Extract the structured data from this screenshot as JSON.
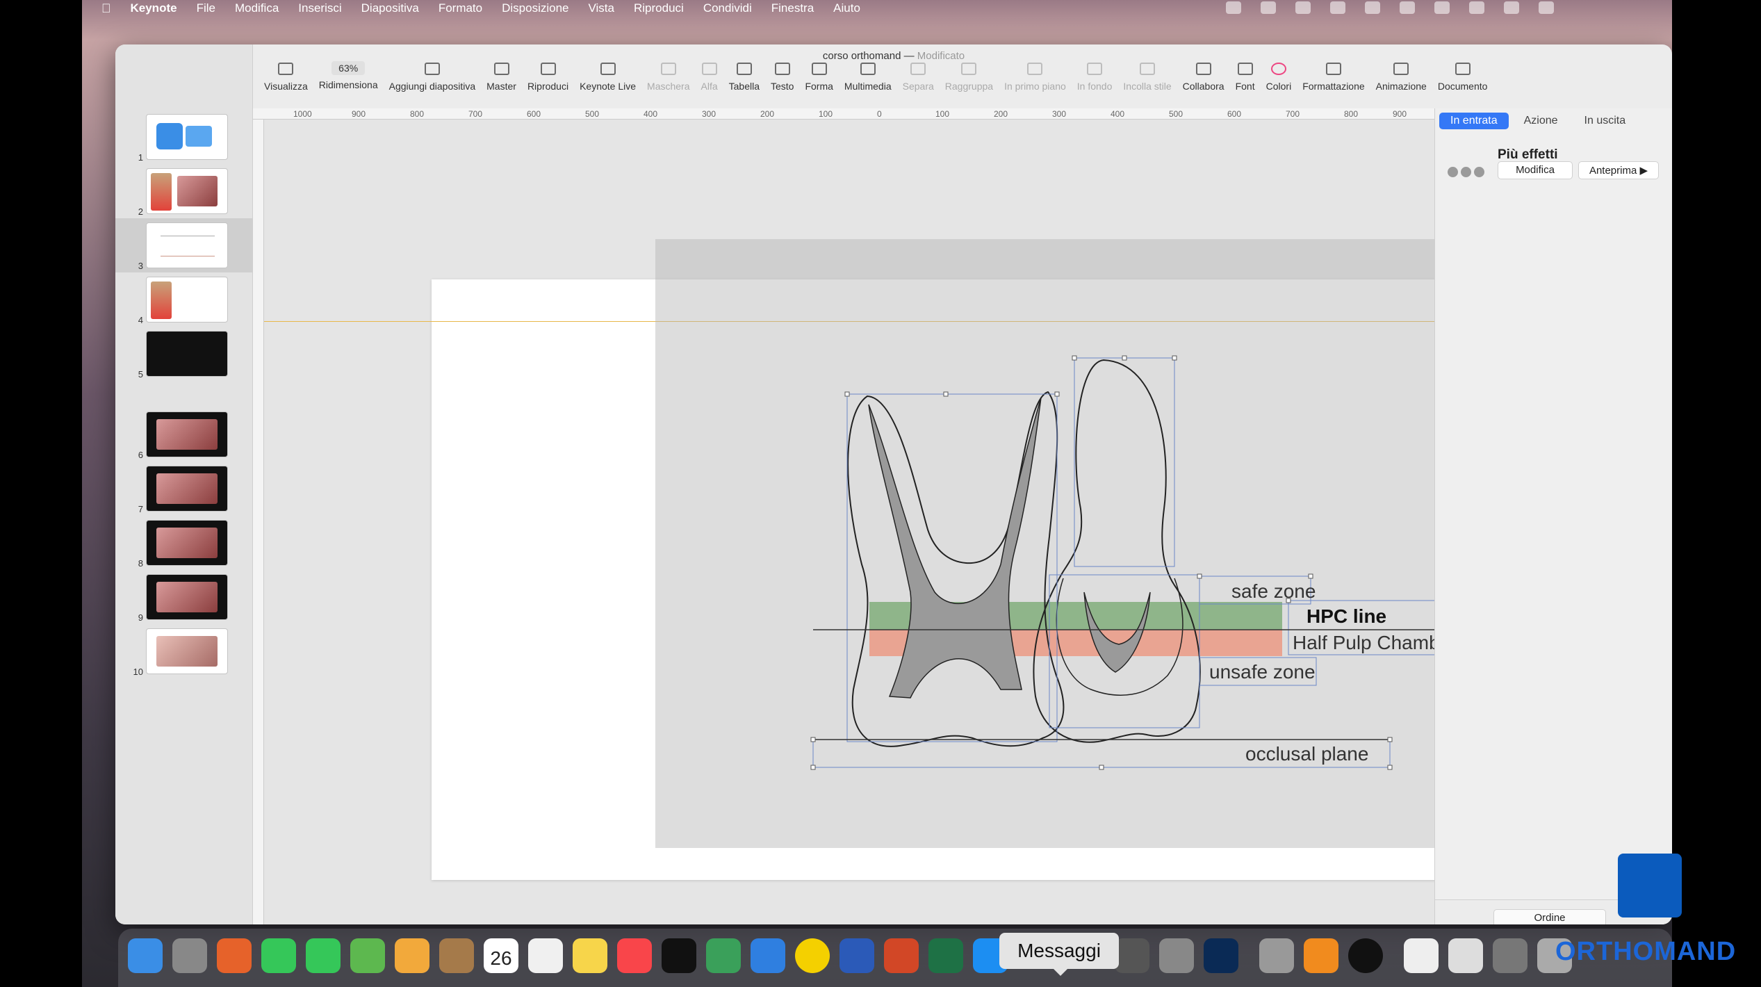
{
  "menubar": {
    "app": "Keynote",
    "items": [
      "File",
      "Modifica",
      "Inserisci",
      "Diapositiva",
      "Formato",
      "Disposizione",
      "Vista",
      "Riproduci",
      "Condividi",
      "Finestra",
      "Aiuto"
    ]
  },
  "window": {
    "title": "corso orthomand",
    "status": "Modificato"
  },
  "toolbar": {
    "zoom": "63%",
    "items": [
      {
        "label": "Visualizza",
        "enabled": true
      },
      {
        "label": "Ridimensiona",
        "enabled": true
      },
      {
        "label": "Aggiungi diapositiva",
        "enabled": true
      },
      {
        "label": "Master",
        "enabled": true
      },
      {
        "label": "Riproduci",
        "enabled": true
      },
      {
        "label": "Keynote Live",
        "enabled": true
      },
      {
        "label": "Maschera",
        "enabled": false
      },
      {
        "label": "Alfa",
        "enabled": false
      },
      {
        "label": "Tabella",
        "enabled": true
      },
      {
        "label": "Testo",
        "enabled": true
      },
      {
        "label": "Forma",
        "enabled": true
      },
      {
        "label": "Multimedia",
        "enabled": true
      },
      {
        "label": "Separa",
        "enabled": false
      },
      {
        "label": "Raggruppa",
        "enabled": false
      },
      {
        "label": "In primo piano",
        "enabled": false
      },
      {
        "label": "In fondo",
        "enabled": false
      },
      {
        "label": "Incolla stile",
        "enabled": false
      },
      {
        "label": "Collabora",
        "enabled": true
      },
      {
        "label": "Font",
        "enabled": true
      },
      {
        "label": "Colori",
        "enabled": true
      },
      {
        "label": "Formattazione",
        "enabled": true
      },
      {
        "label": "Animazione",
        "enabled": true
      },
      {
        "label": "Documento",
        "enabled": true
      }
    ]
  },
  "ruler": {
    "top_labels": [
      "1000",
      "900",
      "800",
      "700",
      "600",
      "500",
      "400",
      "300",
      "200",
      "100",
      "0",
      "100",
      "200",
      "300",
      "400",
      "500",
      "600",
      "700",
      "800",
      "900",
      "1000"
    ]
  },
  "slides": [
    "1",
    "2",
    "3",
    "4",
    "5",
    "6",
    "7",
    "8",
    "9",
    "10"
  ],
  "selected_slide": "3",
  "figure": {
    "safe_zone": "safe zone",
    "hpc_line": "HPC line",
    "half_pulp": "Half Pulp Chamber",
    "unsafe_zone": "unsafe zone",
    "occlusal_plane": "occlusal plane",
    "colors": {
      "safe": "#8fb58a",
      "unsafe": "#e9a492"
    }
  },
  "inspector": {
    "tabs": [
      "In entrata",
      "Azione",
      "In uscita"
    ],
    "active_tab": "In entrata",
    "title": "Più effetti",
    "modify_button": "Modifica",
    "preview_button": "Anteprima ▶",
    "order_button": "Ordine"
  },
  "dock": {
    "tooltip": "Messaggi",
    "calendar_day": "26"
  },
  "brand": {
    "name": "ORTHOMAND"
  }
}
